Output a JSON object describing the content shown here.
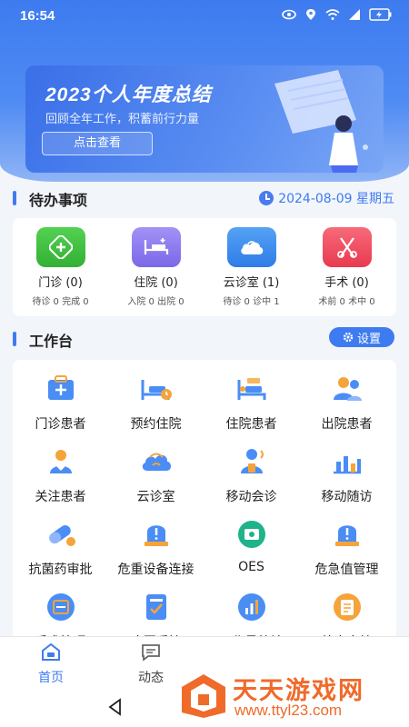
{
  "status": {
    "time": "16:54"
  },
  "banner": {
    "title": "2023个人年度总结",
    "subtitle": "回顾全年工作，积蓄前行力量",
    "button": "点击查看"
  },
  "pending": {
    "title": "待办事项",
    "date": "2024-08-09 星期五",
    "items": [
      {
        "label": "门诊 (0)",
        "sub": "待诊 0 完成 0",
        "color": "#3fbf3f",
        "icon": "outpatient-icon"
      },
      {
        "label": "住院 (0)",
        "sub": "入院 0 出院 0",
        "color": "#8d7cf0",
        "icon": "hospital-bed-icon"
      },
      {
        "label": "云诊室 (1)",
        "sub": "待诊 0 诊中 1",
        "color": "#3b8cf0",
        "icon": "cloud-clinic-icon"
      },
      {
        "label": "手术 (0)",
        "sub": "术前 0 术中 0",
        "color": "#f0455a",
        "icon": "surgery-icon"
      }
    ]
  },
  "workbench": {
    "title": "工作台",
    "settings_label": "设置",
    "items": [
      {
        "label": "门诊患者",
        "icon": "outpatient-patient-icon"
      },
      {
        "label": "预约住院",
        "icon": "appointment-bed-icon"
      },
      {
        "label": "住院患者",
        "icon": "inpatient-icon"
      },
      {
        "label": "出院患者",
        "icon": "discharged-patient-icon"
      },
      {
        "label": "关注患者",
        "icon": "followed-patient-icon"
      },
      {
        "label": "云诊室",
        "icon": "cloud-room-icon"
      },
      {
        "label": "移动会诊",
        "icon": "mobile-consult-icon"
      },
      {
        "label": "移动随访",
        "icon": "mobile-followup-icon"
      },
      {
        "label": "抗菌药审批",
        "icon": "pill-icon"
      },
      {
        "label": "危重设备连接",
        "icon": "alarm-device-icon"
      },
      {
        "label": "OES",
        "icon": "oes-icon"
      },
      {
        "label": "危急值管理",
        "icon": "critical-alarm-icon"
      },
      {
        "label": "手术管理",
        "icon": "surgery-manage-icon"
      },
      {
        "label": "病历质控",
        "icon": "record-qc-icon"
      },
      {
        "label": "工作量统计",
        "icon": "stats-chart-icon"
      },
      {
        "label": "处方审核",
        "icon": "prescription-icon"
      }
    ]
  },
  "nav": {
    "items": [
      {
        "label": "首页",
        "active": true,
        "icon": "home-icon"
      },
      {
        "label": "动态",
        "active": false,
        "icon": "message-icon"
      }
    ]
  },
  "watermark": {
    "text": "天天游戏网",
    "url": "www.ttyl23.com"
  },
  "colors": {
    "primary": "#3e7bf0",
    "watermark": "#f06a2a"
  }
}
